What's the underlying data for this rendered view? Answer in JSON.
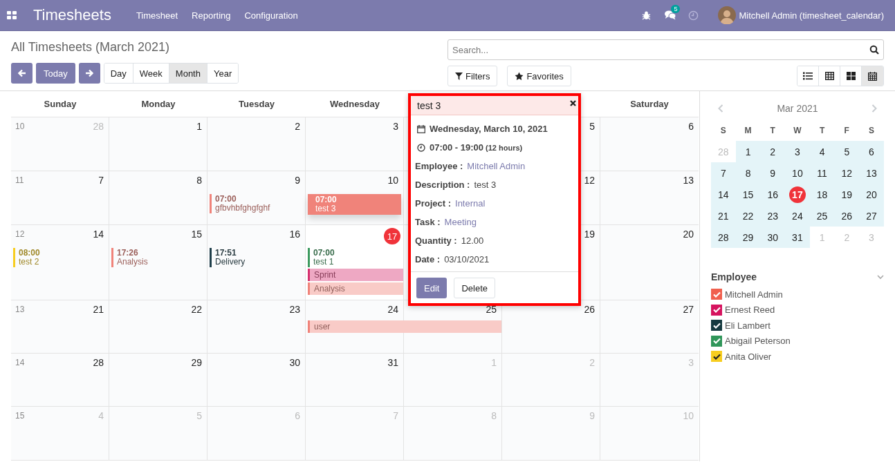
{
  "navbar": {
    "app_title": "Timesheets",
    "menus": [
      "Timesheet",
      "Reporting",
      "Configuration"
    ],
    "message_count": "5",
    "user": "Mitchell Admin (timesheet_calendar)"
  },
  "control_panel": {
    "title": "All Timesheets (March 2021)",
    "today_button": "Today",
    "scales": [
      {
        "label": "Day",
        "selected": false
      },
      {
        "label": "Week",
        "selected": false
      },
      {
        "label": "Month",
        "selected": true
      },
      {
        "label": "Year",
        "selected": false
      }
    ],
    "search": {
      "placeholder": "Search..."
    },
    "filters_button": "Filters",
    "favorites_button": "Favorites",
    "views": [
      {
        "kind": "list",
        "selected": false
      },
      {
        "kind": "pivot",
        "selected": false
      },
      {
        "kind": "kanban",
        "selected": false
      },
      {
        "kind": "calendar",
        "selected": true
      }
    ]
  },
  "calendar": {
    "headers": [
      {
        "label": "Sunday"
      },
      {
        "label": "Monday"
      },
      {
        "label": "Tuesday"
      },
      {
        "label": "Wednesday"
      },
      {
        "covered": true
      },
      {
        "covered": true
      },
      {
        "label": "Saturday"
      }
    ],
    "weeks": [
      {
        "number": "10",
        "days": [
          {
            "date": "28",
            "other_month": true,
            "today": false
          },
          {
            "date": "1",
            "other_month": false,
            "today": false
          },
          {
            "date": "2",
            "other_month": false,
            "today": false
          },
          {
            "date": "3",
            "other_month": false,
            "today": false
          },
          {
            "covered": true
          },
          {
            "date": "5",
            "other_month": false,
            "today": false
          },
          {
            "date": "6",
            "other_month": false,
            "today": false
          }
        ]
      },
      {
        "number": "11",
        "days": [
          {
            "date": "7",
            "other_month": false,
            "today": false
          },
          {
            "date": "8",
            "other_month": false,
            "today": false
          },
          {
            "date": "9",
            "other_month": false,
            "today": false,
            "events": [
              {
                "kind": "timed",
                "time": "07:00",
                "title": "gfbvhbfghgfghf",
                "color": "#f0837a",
                "selected": false
              }
            ]
          },
          {
            "date": "10",
            "other_month": false,
            "today": false,
            "events": [
              {
                "kind": "timed",
                "time": "07:00",
                "title": "test 3",
                "color": "#f0837a",
                "selected": true
              }
            ]
          },
          {
            "covered": true
          },
          {
            "date": "12",
            "other_month": false,
            "today": false
          },
          {
            "date": "13",
            "other_month": false,
            "today": false
          }
        ]
      },
      {
        "number": "12",
        "days": [
          {
            "date": "14",
            "other_month": false,
            "today": false,
            "events": [
              {
                "kind": "timed",
                "time": "08:00",
                "title": "test 2",
                "color": "#f7cd1f",
                "selected": false
              }
            ]
          },
          {
            "date": "15",
            "other_month": false,
            "today": false,
            "events": [
              {
                "kind": "timed",
                "time": "17:26",
                "title": "Analysis",
                "color": "#f0837a",
                "selected": false
              }
            ]
          },
          {
            "date": "16",
            "other_month": false,
            "today": false,
            "events": [
              {
                "kind": "timed",
                "time": "17:51",
                "title": "Delivery",
                "color": "#1f3f4a",
                "selected": false
              }
            ]
          },
          {
            "date": "17",
            "other_month": false,
            "today": true,
            "events": [
              {
                "kind": "timed",
                "time": "07:00",
                "title": "test 1",
                "color": "#3c9a5f",
                "selected": false
              },
              {
                "kind": "bar",
                "title": "Sprint",
                "color": "#d6306f",
                "selected": false
              },
              {
                "kind": "bar",
                "title": "Analysis",
                "color": "#f0837a",
                "selected": false
              }
            ]
          },
          {
            "covered": true
          },
          {
            "date": "19",
            "other_month": false,
            "today": false
          },
          {
            "date": "20",
            "other_month": false,
            "today": false
          }
        ]
      },
      {
        "number": "13",
        "days": [
          {
            "date": "21",
            "other_month": false,
            "today": false
          },
          {
            "date": "22",
            "other_month": false,
            "today": false
          },
          {
            "date": "23",
            "other_month": false,
            "today": false
          },
          {
            "date": "24",
            "other_month": false,
            "today": false,
            "events": [
              {
                "kind": "bar",
                "title": "user",
                "color": "#f0837a",
                "continues": true,
                "selected": false
              }
            ]
          },
          {
            "date": "25",
            "other_month": false,
            "today": false
          },
          {
            "date": "26",
            "other_month": false,
            "today": false
          },
          {
            "date": "27",
            "other_month": false,
            "today": false
          }
        ]
      },
      {
        "number": "14",
        "days": [
          {
            "date": "28",
            "other_month": false,
            "today": false
          },
          {
            "date": "29",
            "other_month": false,
            "today": false
          },
          {
            "date": "30",
            "other_month": false,
            "today": false
          },
          {
            "date": "31",
            "other_month": false,
            "today": false
          },
          {
            "date": "1",
            "other_month": true,
            "today": false
          },
          {
            "date": "2",
            "other_month": true,
            "today": false
          },
          {
            "date": "3",
            "other_month": true,
            "today": false
          }
        ]
      },
      {
        "number": "15",
        "days": [
          {
            "date": "4",
            "other_month": true,
            "today": false
          },
          {
            "date": "5",
            "other_month": true,
            "today": false
          },
          {
            "date": "6",
            "other_month": true,
            "today": false
          },
          {
            "date": "7",
            "other_month": true,
            "today": false
          },
          {
            "date": "8",
            "other_month": true,
            "today": false
          },
          {
            "date": "9",
            "other_month": true,
            "today": false
          },
          {
            "date": "10",
            "other_month": true,
            "today": false
          }
        ]
      }
    ]
  },
  "popover": {
    "title": "test 3",
    "date": "Wednesday, March 10, 2021",
    "time": "07:00 - 19:00",
    "duration": "(12 hours)",
    "fields": [
      {
        "label": "Employee :",
        "value": "Mitchell Admin",
        "kind": "link"
      },
      {
        "label": "Description :",
        "value": "test 3",
        "kind": "text"
      },
      {
        "label": "Project :",
        "value": "Internal",
        "kind": "link"
      },
      {
        "label": "Task :",
        "value": "Meeting",
        "kind": "link"
      },
      {
        "label": "Quantity :",
        "value": "12.00",
        "kind": "text"
      },
      {
        "label": "Date :",
        "value": "03/10/2021",
        "kind": "text"
      }
    ],
    "buttons": [
      "Edit",
      "Delete"
    ]
  },
  "sidebar": {
    "month": "Mar 2021",
    "weekdays": [
      "S",
      "M",
      "T",
      "W",
      "T",
      "F",
      "S"
    ],
    "weeks": [
      [
        {
          "day": "28",
          "in_month": false,
          "today": false
        },
        {
          "day": "1",
          "in_month": true,
          "today": false
        },
        {
          "day": "2",
          "in_month": true,
          "today": false
        },
        {
          "day": "3",
          "in_month": true,
          "today": false
        },
        {
          "day": "4",
          "in_month": true,
          "today": false
        },
        {
          "day": "5",
          "in_month": true,
          "today": false
        },
        {
          "day": "6",
          "in_month": true,
          "today": false
        }
      ],
      [
        {
          "day": "7",
          "in_month": true,
          "today": false
        },
        {
          "day": "8",
          "in_month": true,
          "today": false
        },
        {
          "day": "9",
          "in_month": true,
          "today": false
        },
        {
          "day": "10",
          "in_month": true,
          "today": false
        },
        {
          "day": "11",
          "in_month": true,
          "today": false
        },
        {
          "day": "12",
          "in_month": true,
          "today": false
        },
        {
          "day": "13",
          "in_month": true,
          "today": false
        }
      ],
      [
        {
          "day": "14",
          "in_month": true,
          "today": false
        },
        {
          "day": "15",
          "in_month": true,
          "today": false
        },
        {
          "day": "16",
          "in_month": true,
          "today": false
        },
        {
          "day": "17",
          "in_month": true,
          "today": true
        },
        {
          "day": "18",
          "in_month": true,
          "today": false
        },
        {
          "day": "19",
          "in_month": true,
          "today": false
        },
        {
          "day": "20",
          "in_month": true,
          "today": false
        }
      ],
      [
        {
          "day": "21",
          "in_month": true,
          "today": false
        },
        {
          "day": "22",
          "in_month": true,
          "today": false
        },
        {
          "day": "23",
          "in_month": true,
          "today": false
        },
        {
          "day": "24",
          "in_month": true,
          "today": false
        },
        {
          "day": "25",
          "in_month": true,
          "today": false
        },
        {
          "day": "26",
          "in_month": true,
          "today": false
        },
        {
          "day": "27",
          "in_month": true,
          "today": false
        }
      ],
      [
        {
          "day": "28",
          "in_month": true,
          "today": false
        },
        {
          "day": "29",
          "in_month": true,
          "today": false
        },
        {
          "day": "30",
          "in_month": true,
          "today": false
        },
        {
          "day": "31",
          "in_month": true,
          "today": false
        },
        {
          "day": "1",
          "in_month": false,
          "today": false
        },
        {
          "day": "2",
          "in_month": false,
          "today": false
        },
        {
          "day": "3",
          "in_month": false,
          "today": false
        }
      ]
    ],
    "filter_title": "Employee",
    "employees": [
      {
        "name": "Mitchell Admin",
        "color": "#f0604e",
        "checked": true
      },
      {
        "name": "Ernest Reed",
        "color": "#d6145f",
        "checked": true
      },
      {
        "name": "Eli Lambert",
        "color": "#163a40",
        "checked": true
      },
      {
        "name": "Abigail Peterson",
        "color": "#30965a",
        "checked": true
      },
      {
        "name": "Anita Oliver",
        "color": "#f7cd1f",
        "checked": true
      }
    ]
  }
}
